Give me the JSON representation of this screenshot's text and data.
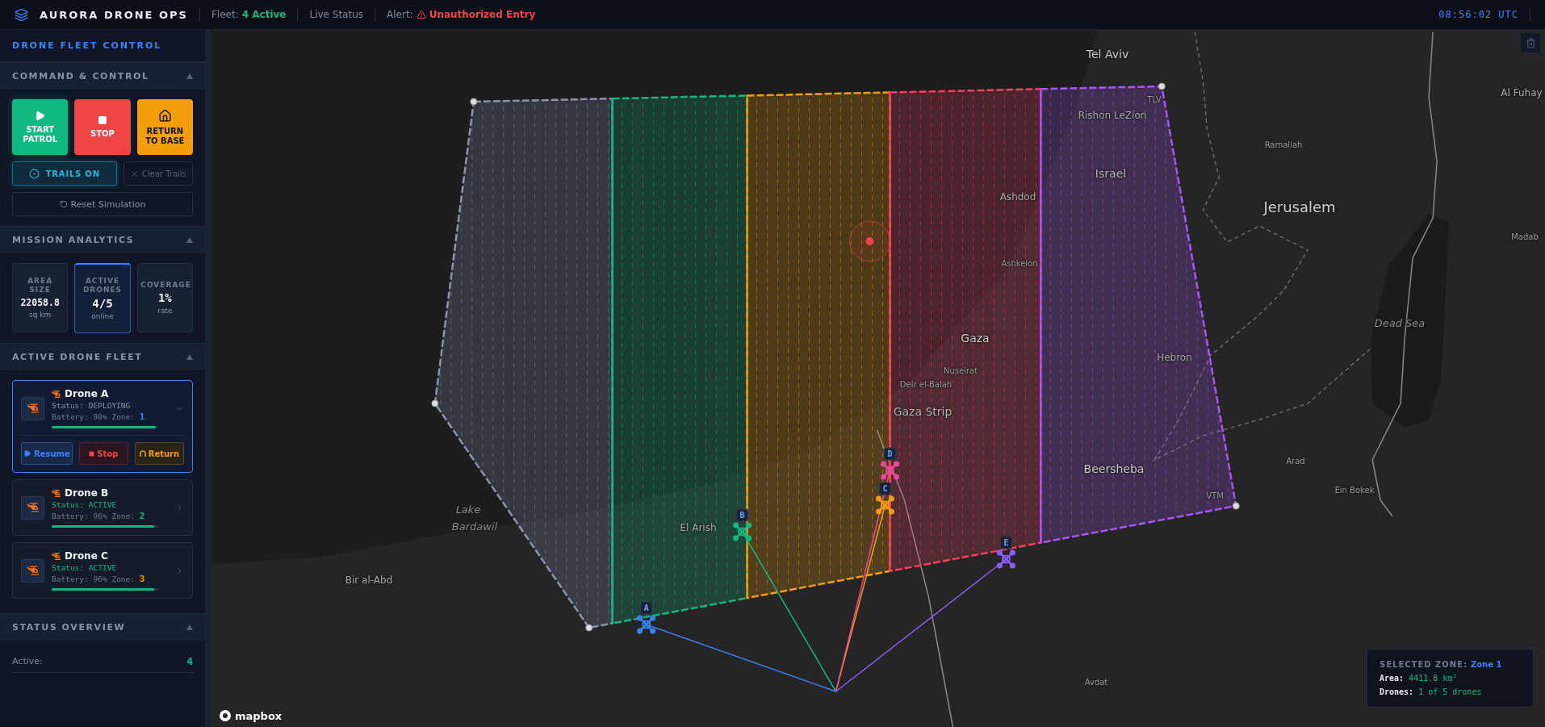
{
  "header": {
    "brand": "AURORA DRONE OPS",
    "fleet_label": "Fleet:",
    "fleet_value": "4 Active",
    "live_status": "Live Status",
    "alert_label": "Alert:",
    "alert_value": "Unauthorized Entry",
    "clock": "08:56:02 UTC"
  },
  "sidebar": {
    "title": "DRONE FLEET CONTROL",
    "command": {
      "title": "COMMAND & CONTROL",
      "expanded": true,
      "actions": [
        {
          "kind": "start",
          "label": "START PATROL"
        },
        {
          "kind": "stop",
          "label": "STOP"
        },
        {
          "kind": "return",
          "label": "RETURN TO BASE"
        }
      ],
      "trails": {
        "label": "TRAILS ON",
        "on": true
      },
      "clear_label": "Clear Trails",
      "reset_label": "Reset Simulation"
    },
    "analytics": {
      "title": "MISSION ANALYTICS",
      "expanded": true,
      "metrics": [
        {
          "label": "AREA SIZE",
          "value": "22058.8",
          "unit": "sq km",
          "selected": false
        },
        {
          "label": "ACTIVE DRONES",
          "value": "4/5",
          "unit": "online",
          "selected": true
        },
        {
          "label": "COVERAGE",
          "value": "1%",
          "unit": "rate",
          "selected": false
        }
      ]
    },
    "fleet": {
      "title": "ACTIVE DRONE FLEET",
      "expanded": true,
      "drones": [
        {
          "name": "Drone A",
          "status_label": "Status:",
          "status": "DEPLOYING",
          "kind": "deploying",
          "battery_label": "Battery:",
          "battery": "98%",
          "level": 0.98,
          "zone_label": "Zone:",
          "zone": "1",
          "color": "#3b82f6",
          "expanded": true,
          "actions": [
            {
              "kind": "resume",
              "label": "Resume"
            },
            {
              "kind": "stop",
              "label": "Stop"
            },
            {
              "kind": "return",
              "label": "Return"
            }
          ]
        },
        {
          "name": "Drone B",
          "status_label": "Status:",
          "status": "ACTIVE",
          "kind": "active",
          "battery_label": "Battery:",
          "battery": "96%",
          "level": 0.96,
          "zone_label": "Zone:",
          "zone": "2",
          "color": "#10b981",
          "expanded": false
        },
        {
          "name": "Drone C",
          "status_label": "Status:",
          "status": "ACTIVE",
          "kind": "active",
          "battery_label": "Battery:",
          "battery": "96%",
          "level": 0.96,
          "zone_label": "Zone:",
          "zone": "3",
          "color": "#f59e0b",
          "expanded": false
        }
      ]
    },
    "status_overview": {
      "title": "STATUS OVERVIEW",
      "expanded": true,
      "rows": [
        {
          "label": "Active:",
          "value": "4"
        }
      ]
    }
  },
  "map": {
    "zones": [
      {
        "color": "#8a94b0"
      },
      {
        "color": "#10b981"
      },
      {
        "color": "#f59e0b"
      },
      {
        "color": "#f43f5e"
      },
      {
        "color": "#a855f7"
      }
    ],
    "drones": [
      {
        "tag": "A",
        "color": "#3b82f6"
      },
      {
        "tag": "B",
        "color": "#10b981"
      },
      {
        "tag": "C",
        "color": "#f59e0b"
      },
      {
        "tag": "D",
        "color": "#ec4899"
      },
      {
        "tag": "E",
        "color": "#8b5cf6"
      }
    ],
    "places": [
      {
        "name": "Tel Aviv",
        "kind": "city"
      },
      {
        "name": "TLV",
        "kind": "small"
      },
      {
        "name": "Rishon LeZion",
        "kind": "town"
      },
      {
        "name": "Al Fuhay",
        "kind": "town"
      },
      {
        "name": "Ramallah",
        "kind": "small"
      },
      {
        "name": "Israel",
        "kind": "country"
      },
      {
        "name": "Jerusalem",
        "kind": "capital"
      },
      {
        "name": "Ashdod",
        "kind": "town"
      },
      {
        "name": "Madab",
        "kind": "small"
      },
      {
        "name": "Ashkelon",
        "kind": "small"
      },
      {
        "name": "Dead Sea",
        "kind": "water"
      },
      {
        "name": "Gaza",
        "kind": "city"
      },
      {
        "name": "Hebron",
        "kind": "town"
      },
      {
        "name": "Nuseirat",
        "kind": "small"
      },
      {
        "name": "Deir el-Balah",
        "kind": "small"
      },
      {
        "name": "Gaza Strip",
        "kind": "country"
      },
      {
        "name": "Beersheba",
        "kind": "city"
      },
      {
        "name": "Arad",
        "kind": "small"
      },
      {
        "name": "VTM",
        "kind": "small"
      },
      {
        "name": "Ein Bokek",
        "kind": "small"
      },
      {
        "name": "Lake",
        "kind": "water"
      },
      {
        "name": "Bardawil",
        "kind": "water"
      },
      {
        "name": "El Arish",
        "kind": "town"
      },
      {
        "name": "Bir al-Abd",
        "kind": "town"
      },
      {
        "name": "Avdat",
        "kind": "small"
      }
    ],
    "attribution": "mapbox",
    "selected_zone": {
      "title": "SELECTED ZONE:",
      "zone": "Zone 1",
      "area_label": "Area:",
      "area": "4411.8 km²",
      "drones_label": "Drones:",
      "drones": "1 of 5 drones"
    }
  }
}
